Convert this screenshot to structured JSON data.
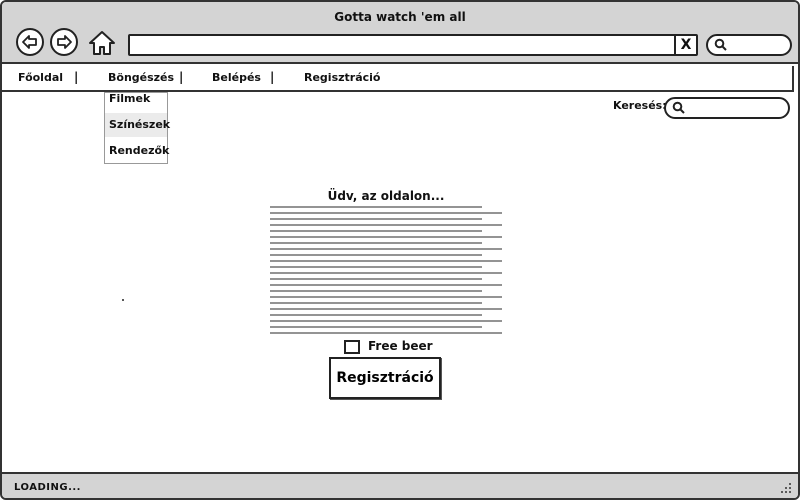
{
  "window": {
    "title": "Gotta watch 'em all"
  },
  "browser": {
    "back_icon": "back-arrow-icon",
    "forward_icon": "forward-arrow-icon",
    "home_icon": "home-icon",
    "url_value": "",
    "clear_symbol": "X",
    "search_icon": "search-icon"
  },
  "menu": {
    "items": [
      {
        "label": "Főoldal"
      },
      {
        "label": "Böngészés"
      },
      {
        "label": "Belépés"
      },
      {
        "label": "Regisztráció"
      }
    ],
    "separator": "|"
  },
  "dropdown": {
    "items": [
      {
        "label": "Filmek"
      },
      {
        "label": "Színészek"
      },
      {
        "label": "Rendezők"
      }
    ]
  },
  "site_search": {
    "label": "Keresés:",
    "value": ""
  },
  "welcome": {
    "title": "Üdv, az oldalon..."
  },
  "form": {
    "checkbox_label": "Free beer",
    "checkbox_checked": false,
    "register_button": "Regisztráció"
  },
  "status": {
    "text": "LOADING..."
  },
  "colors": {
    "chrome": "#d4d4d4",
    "border": "#333333",
    "hover": "#ebebeb"
  }
}
